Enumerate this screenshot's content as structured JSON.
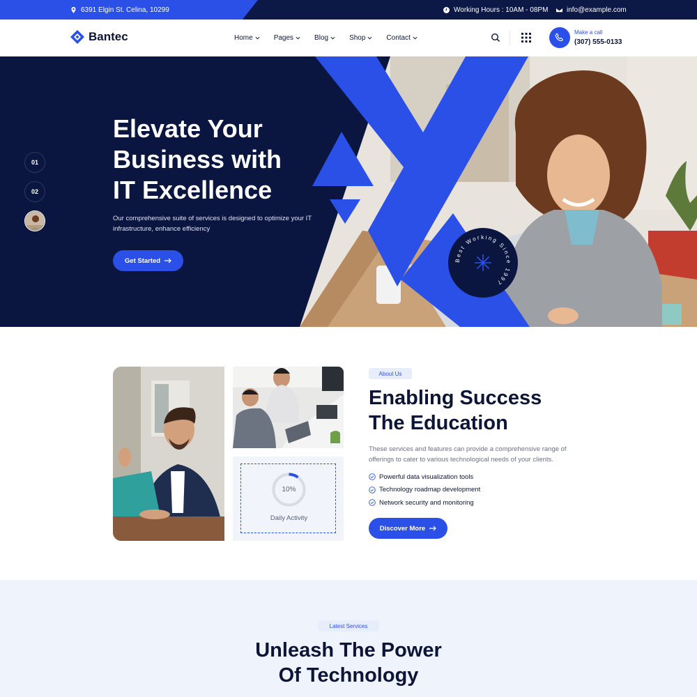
{
  "topbar": {
    "address": "6391 Elgin St. Celina, 10299",
    "hours": "Working Hours : 10AM - 08PM",
    "email": "info@example.com"
  },
  "header": {
    "logo_text": "Bantec",
    "nav": [
      {
        "label": "Home"
      },
      {
        "label": "Pages"
      },
      {
        "label": "Blog"
      },
      {
        "label": "Shop"
      },
      {
        "label": "Contact"
      }
    ],
    "call_label": "Make a call",
    "call_number": "(307) 555-0133"
  },
  "hero": {
    "title_lines": [
      "Elevate Your",
      "Business with",
      "IT Excellence"
    ],
    "description": "Our comprehensive suite of services is designed to optimize your IT infrastructure, enhance efficiency",
    "cta_label": "Get Started",
    "slides": [
      "01",
      "02"
    ],
    "badge_text": "Best Working Since 1997"
  },
  "about": {
    "tag": "About Us",
    "title_lines": [
      "Enabling Success",
      "The Education"
    ],
    "description": "These services and features can provide a comprehensive range of offerings to cater to various technological needs of your clients.",
    "features": [
      "Powerful data visualization tools",
      "Technology roadmap development",
      "Network security and monitoring"
    ],
    "cta_label": "Discover More",
    "activity": {
      "value": "10%",
      "progress": 0.1,
      "label": "Daily Activity"
    }
  },
  "services": {
    "tag": "Latest Services",
    "title_lines": [
      "Unleash The Power",
      "Of Technology"
    ]
  },
  "colors": {
    "brand_blue": "#2a50e8",
    "navy": "#0b1640",
    "light_bg": "#eff3fb"
  },
  "icons": [
    "location-pin-icon",
    "clock-icon",
    "mail-icon",
    "search-icon",
    "grid-menu-icon",
    "phone-icon",
    "arrow-right-icon",
    "check-circle-icon",
    "chevron-down-icon"
  ]
}
